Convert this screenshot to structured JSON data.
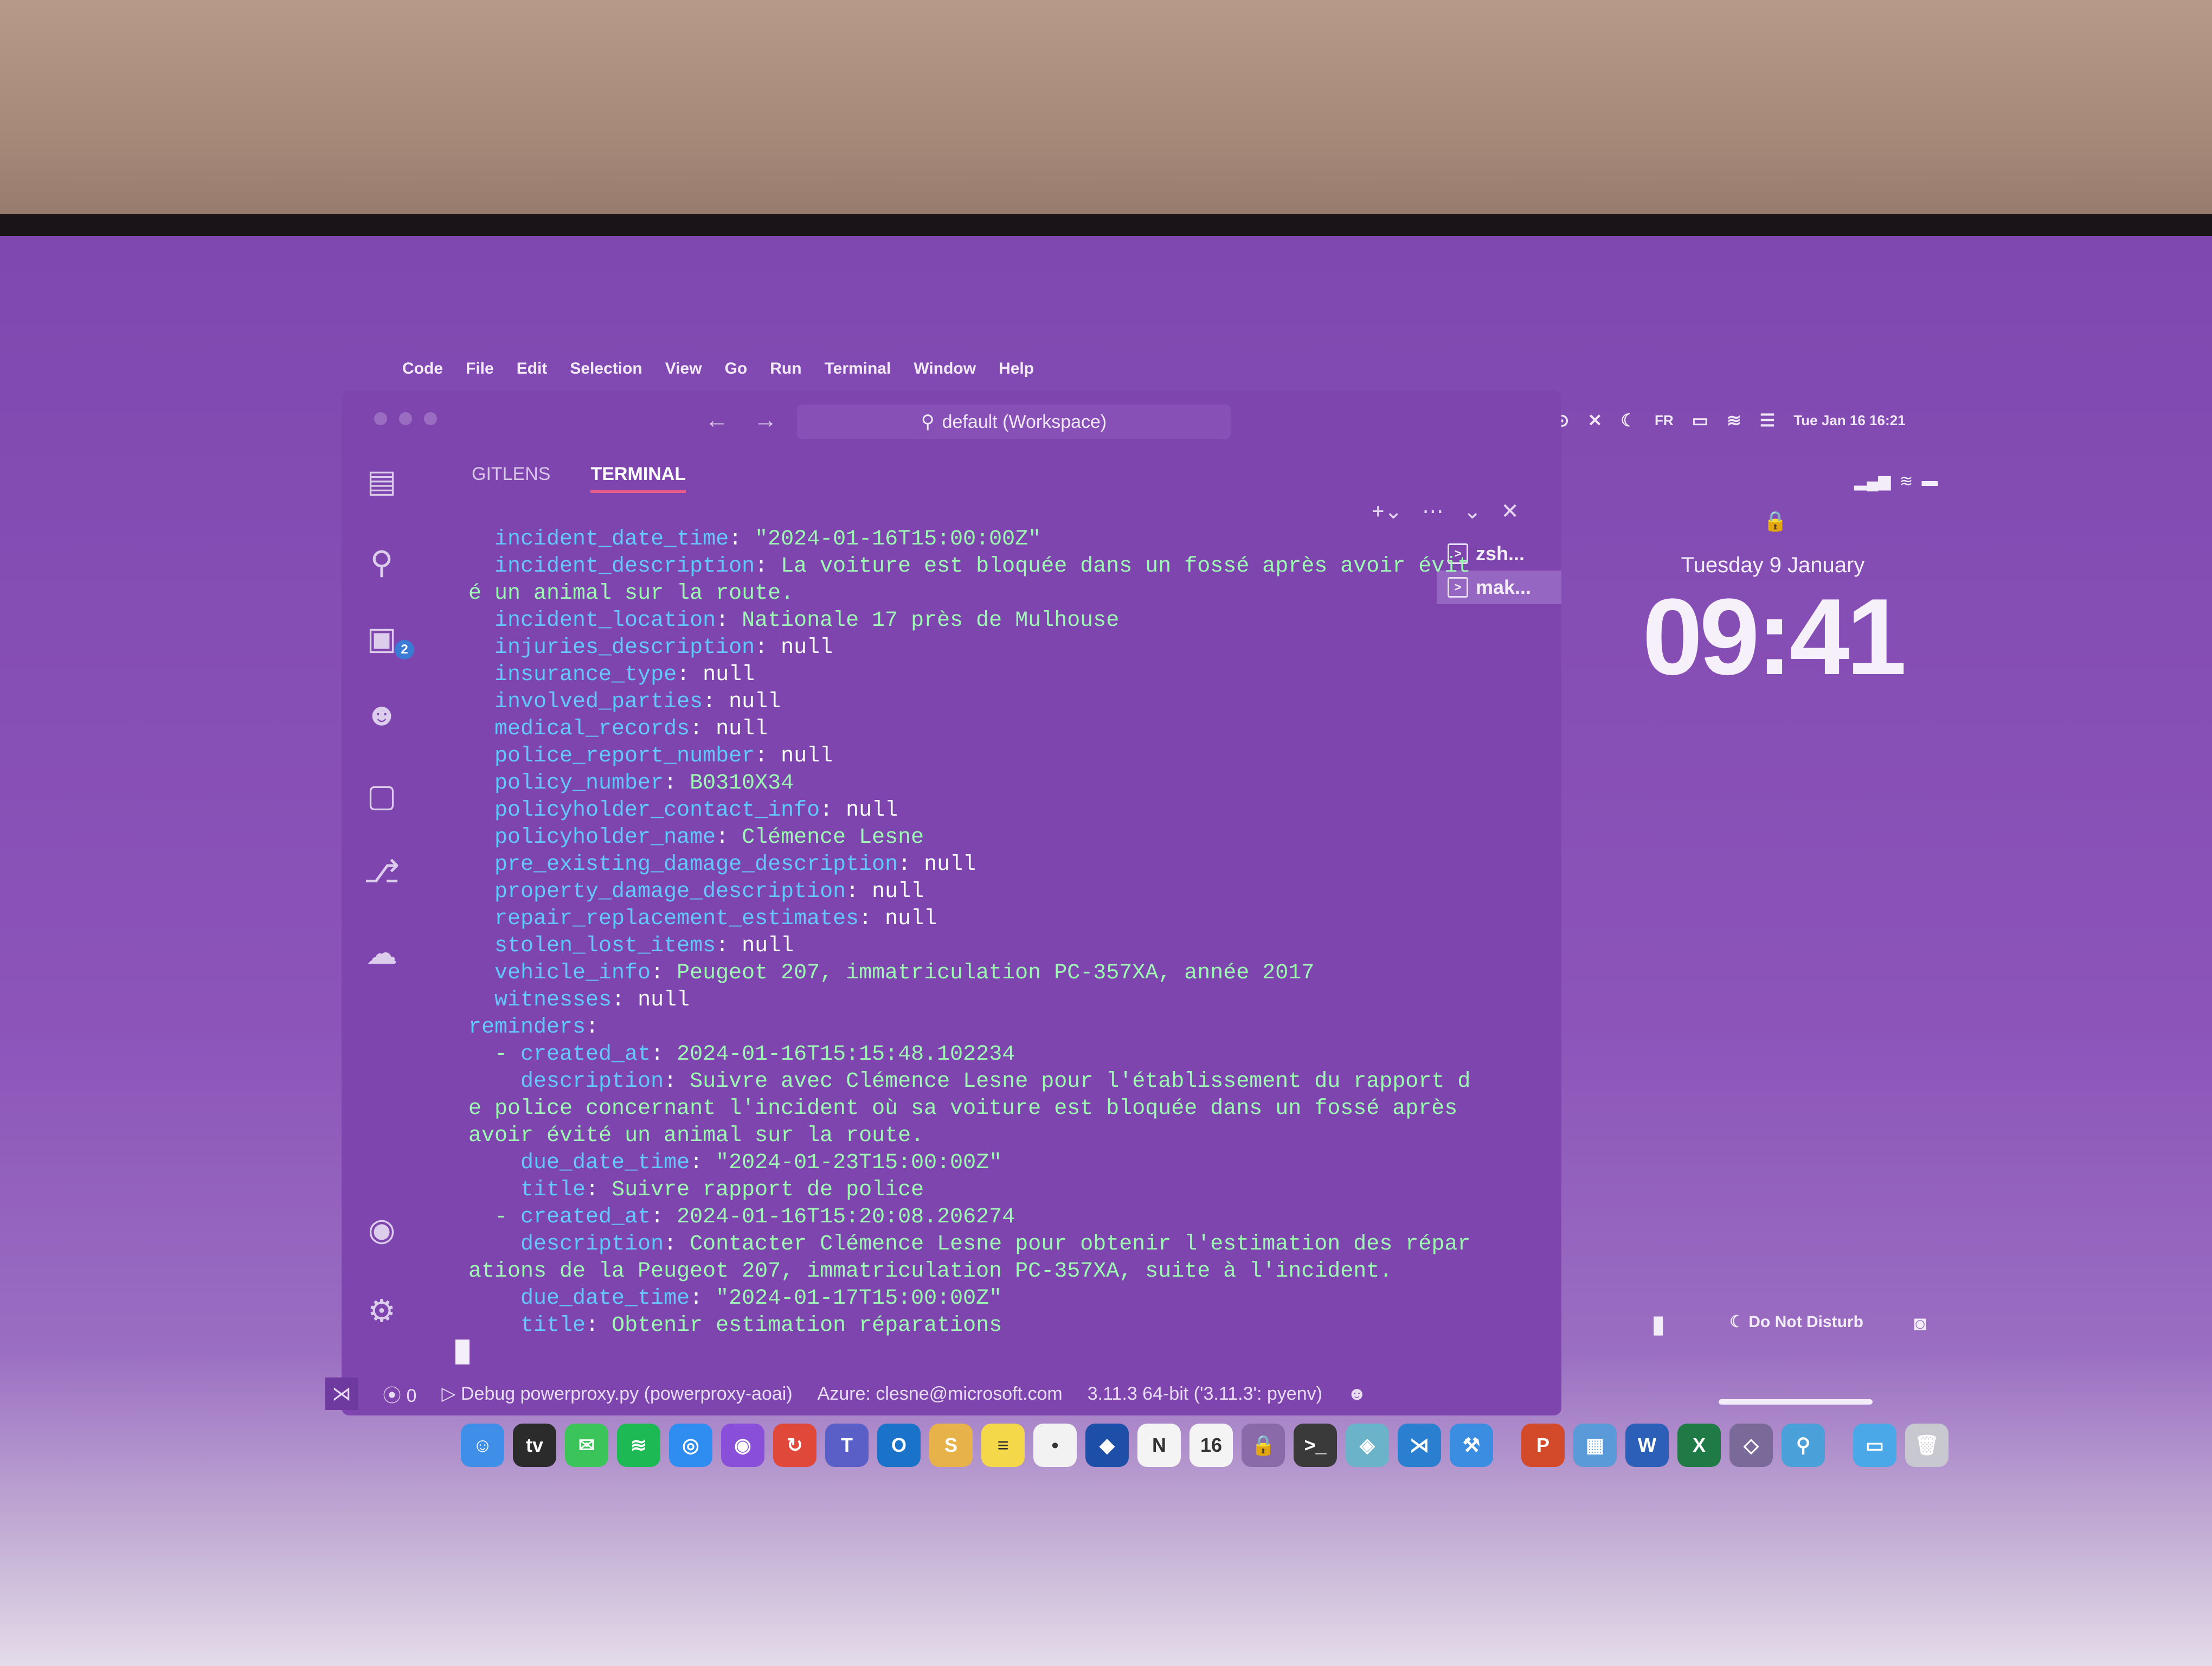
{
  "menubar": {
    "app": "Code",
    "items": [
      "File",
      "Edit",
      "Selection",
      "View",
      "Go",
      "Run",
      "Terminal",
      "Window",
      "Help"
    ],
    "clock": "Tue Jan 16  16:21",
    "lang": "FR"
  },
  "window": {
    "search": "default (Workspace)"
  },
  "activity": {
    "extensions_badge": "2"
  },
  "panel": {
    "tabs": [
      {
        "label": "GITLENS",
        "active": false
      },
      {
        "label": "TERMINAL",
        "active": true
      }
    ],
    "terminals": [
      "zsh...",
      "mak..."
    ]
  },
  "terminal": {
    "lines": [
      {
        "indent": "   ",
        "key": "incident_date_time",
        "value": "\"2024-01-16T15:00:00Z\"",
        "kind": "s"
      },
      {
        "indent": "   ",
        "key": "incident_description",
        "value": "La voiture est bloquée dans un fossé après avoir évit",
        "kind": "s"
      },
      {
        "indent": " ",
        "key": "",
        "value": "é un animal sur la route.",
        "kind": "s"
      },
      {
        "indent": "   ",
        "key": "incident_location",
        "value": "Nationale 17 près de Mulhouse",
        "kind": "s"
      },
      {
        "indent": "   ",
        "key": "injuries_description",
        "value": "null",
        "kind": "n"
      },
      {
        "indent": "   ",
        "key": "insurance_type",
        "value": "null",
        "kind": "n"
      },
      {
        "indent": "   ",
        "key": "involved_parties",
        "value": "null",
        "kind": "n"
      },
      {
        "indent": "   ",
        "key": "medical_records",
        "value": "null",
        "kind": "n"
      },
      {
        "indent": "   ",
        "key": "police_report_number",
        "value": "null",
        "kind": "n"
      },
      {
        "indent": "   ",
        "key": "policy_number",
        "value": "B0310X34",
        "kind": "s"
      },
      {
        "indent": "   ",
        "key": "policyholder_contact_info",
        "value": "null",
        "kind": "n"
      },
      {
        "indent": "   ",
        "key": "policyholder_name",
        "value": "Clémence Lesne",
        "kind": "s"
      },
      {
        "indent": "   ",
        "key": "pre_existing_damage_description",
        "value": "null",
        "kind": "n"
      },
      {
        "indent": "   ",
        "key": "property_damage_description",
        "value": "null",
        "kind": "n"
      },
      {
        "indent": "   ",
        "key": "repair_replacement_estimates",
        "value": "null",
        "kind": "n"
      },
      {
        "indent": "   ",
        "key": "stolen_lost_items",
        "value": "null",
        "kind": "n"
      },
      {
        "indent": "   ",
        "key": "vehicle_info",
        "value": "Peugeot 207, immatriculation PC-357XA, année 2017",
        "kind": "s"
      },
      {
        "indent": "   ",
        "key": "witnesses",
        "value": "null",
        "kind": "n"
      },
      {
        "indent": " ",
        "key": "reminders",
        "value": "",
        "kind": "s"
      },
      {
        "indent": "   - ",
        "key": "created_at",
        "value": "2024-01-16T15:15:48.102234",
        "kind": "s"
      },
      {
        "indent": "     ",
        "key": "description",
        "value": "Suivre avec Clémence Lesne pour l'établissement du rapport d",
        "kind": "s"
      },
      {
        "indent": " ",
        "key": "",
        "value": "e police concernant l'incident où sa voiture est bloquée dans un fossé après",
        "kind": "s"
      },
      {
        "indent": " ",
        "key": "",
        "value": "avoir évité un animal sur la route.",
        "kind": "s"
      },
      {
        "indent": "     ",
        "key": "due_date_time",
        "value": "\"2024-01-23T15:00:00Z\"",
        "kind": "s"
      },
      {
        "indent": "     ",
        "key": "title",
        "value": "Suivre rapport de police",
        "kind": "s"
      },
      {
        "indent": "   - ",
        "key": "created_at",
        "value": "2024-01-16T15:20:08.206274",
        "kind": "s"
      },
      {
        "indent": "     ",
        "key": "description",
        "value": "Contacter Clémence Lesne pour obtenir l'estimation des répar",
        "kind": "s"
      },
      {
        "indent": " ",
        "key": "",
        "value": "ations de la Peugeot 207, immatriculation PC-357XA, suite à l'incident.",
        "kind": "s"
      },
      {
        "indent": "     ",
        "key": "due_date_time",
        "value": "\"2024-01-17T15:00:00Z\"",
        "kind": "s"
      },
      {
        "indent": "     ",
        "key": "title",
        "value": "Obtenir estimation réparations",
        "kind": "s"
      }
    ]
  },
  "statusbar": {
    "ports": "0",
    "debug": "Debug powerproxy.py (powerproxy-aoai)",
    "account": "Azure: clesne@microsoft.com",
    "python": "3.11.3 64-bit ('3.11.3': pyenv)"
  },
  "lockscreen": {
    "date": "Tuesday 9 January",
    "time": "09:41",
    "dnd": "Do Not Disturb"
  },
  "dock": {
    "icons": [
      {
        "name": "finder",
        "color": "#3f8fe8",
        "glyph": "☺"
      },
      {
        "name": "apple-tv",
        "color": "#2b2b2b",
        "glyph": "tv"
      },
      {
        "name": "messages",
        "color": "#3bc45a",
        "glyph": "✉"
      },
      {
        "name": "spotify",
        "color": "#1db954",
        "glyph": "≋"
      },
      {
        "name": "safari",
        "color": "#2f8cf0",
        "glyph": "◎"
      },
      {
        "name": "podcasts",
        "color": "#8a4fd8",
        "glyph": "◉"
      },
      {
        "name": "remote-desktop",
        "color": "#e0483a",
        "glyph": "↻"
      },
      {
        "name": "teams",
        "color": "#5a5fc8",
        "glyph": "T"
      },
      {
        "name": "outlook",
        "color": "#1a73c8",
        "glyph": "O"
      },
      {
        "name": "sonos",
        "color": "#e8b24a",
        "glyph": "S"
      },
      {
        "name": "notes",
        "color": "#f5d84a",
        "glyph": "≡"
      },
      {
        "name": "reminders",
        "color": "#f2f2f2",
        "glyph": "•"
      },
      {
        "name": "bitwarden",
        "color": "#1d4ea8",
        "glyph": "◆"
      },
      {
        "name": "notion",
        "color": "#f4f4f4",
        "glyph": "N"
      },
      {
        "name": "calendar",
        "color": "#f4f4f4",
        "glyph": "16"
      },
      {
        "name": "keychain",
        "color": "#8a6aa8",
        "glyph": "🔒"
      },
      {
        "name": "terminal",
        "color": "#3a3a3a",
        "glyph": ">_"
      },
      {
        "name": "network",
        "color": "#6ab3c8",
        "glyph": "◈"
      },
      {
        "name": "vscode",
        "color": "#2a7fd0",
        "glyph": "⋊"
      },
      {
        "name": "xcode",
        "color": "#3a8de0",
        "glyph": "⚒"
      },
      {
        "name": "powerpoint",
        "color": "#d24a2a",
        "glyph": "P"
      },
      {
        "name": "preview",
        "color": "#5a9ad8",
        "glyph": "▦"
      },
      {
        "name": "word",
        "color": "#2b5fb8",
        "glyph": "W"
      },
      {
        "name": "excel",
        "color": "#1f7a45",
        "glyph": "X"
      },
      {
        "name": "app-store",
        "color": "#7a6a9a",
        "glyph": "◇"
      },
      {
        "name": "magnifier",
        "color": "#4aa0d8",
        "glyph": "⚲"
      },
      {
        "name": "downloads-folder",
        "color": "#4aa8e8",
        "glyph": "▭"
      },
      {
        "name": "trash",
        "color": "#c8c8d0",
        "glyph": "🗑"
      }
    ]
  }
}
